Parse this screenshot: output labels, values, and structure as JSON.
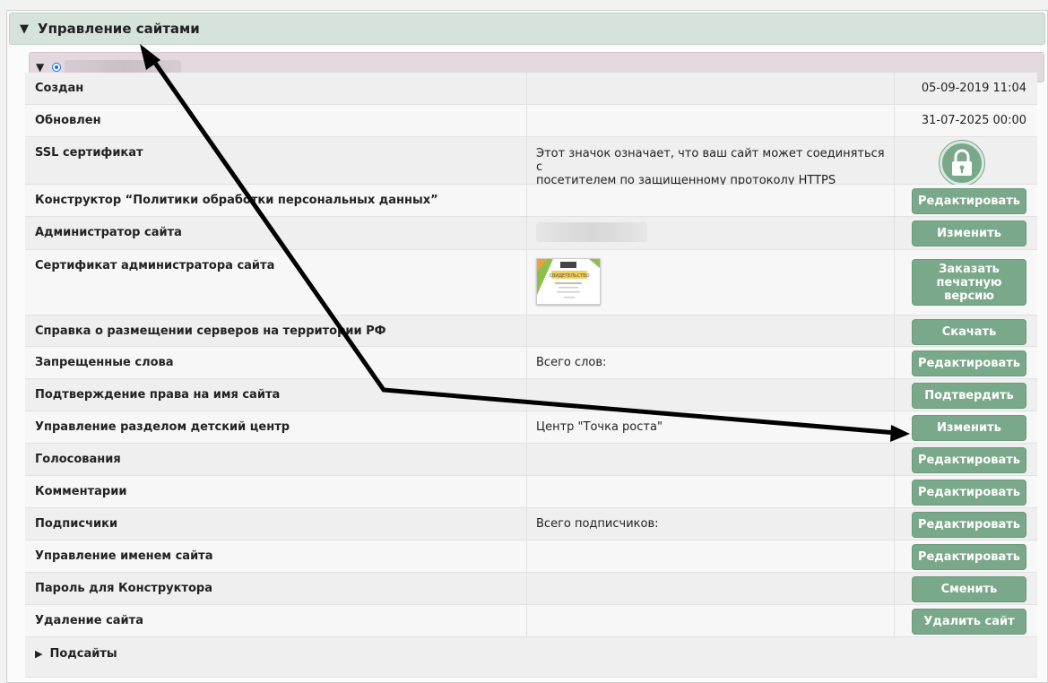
{
  "section": {
    "title": "Управление сайтами"
  },
  "rows": [
    {
      "label": "Создан",
      "date": "05-09-2019 11:04"
    },
    {
      "label": "Обновлен",
      "date": "31-07-2025 00:00"
    },
    {
      "label": "SSL сертификат",
      "info_line1": "Этот значок означает, что ваш сайт может соединяться с",
      "info_line2": "посетителем по защищенному протоколу HTTPS"
    },
    {
      "label": "Конструктор “Политики обработки персональных данных”",
      "button": "Редактировать"
    },
    {
      "label": "Администратор сайта",
      "button": "Изменить"
    },
    {
      "label": "Сертификат администратора сайта",
      "button": "Заказать печатную версию",
      "cert_text": "СВИДЕТЕЛЬСТВО"
    },
    {
      "label": "Справка о размещении серверов на территории РФ",
      "button": "Скачать"
    },
    {
      "label": "Запрещенные слова",
      "info": "Всего слов:",
      "button": "Редактировать"
    },
    {
      "label": "Подтверждение права на имя сайта",
      "button": "Подтвердить"
    },
    {
      "label": "Управление разделом детский центр",
      "info": "Центр \"Точка роста\"",
      "button": "Изменить"
    },
    {
      "label": "Голосования",
      "button": "Редактировать"
    },
    {
      "label": "Комментарии",
      "button": "Редактировать"
    },
    {
      "label": "Подписчики",
      "info": "Всего подписчиков:",
      "button": "Редактировать"
    },
    {
      "label": "Управление именем сайта",
      "button": "Редактировать"
    },
    {
      "label": "Пароль для Конструктора",
      "button": "Сменить"
    },
    {
      "label": "Удаление сайта",
      "button": "Удалить сайт"
    }
  ],
  "subsites": {
    "label": "Подсайты"
  },
  "colors": {
    "button": "#7aa88a",
    "section_header": "#d6e3da",
    "site_header": "#e3d8de",
    "arrow": "#000000"
  }
}
